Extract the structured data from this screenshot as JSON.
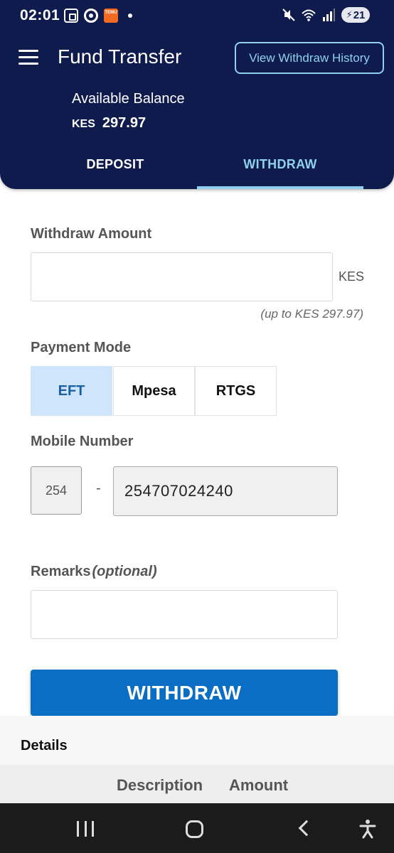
{
  "status_bar": {
    "time": "02:01",
    "temu_label": "TEMU",
    "battery_level": "21"
  },
  "header": {
    "title": "Fund Transfer",
    "history_button": "View Withdraw History",
    "balance_label": "Available Balance",
    "balance_currency": "KES",
    "balance_value": "297.97",
    "accent_color": "#8ed0ee",
    "background_color": "#0f1b4d"
  },
  "tabs": [
    {
      "label": "DEPOSIT",
      "active": false
    },
    {
      "label": "WITHDRAW",
      "active": true
    }
  ],
  "form": {
    "amount_label": "Withdraw Amount",
    "amount_value": "",
    "amount_currency": "KES",
    "amount_hint": "(up to KES 297.97)",
    "payment_mode_label": "Payment Mode",
    "payment_modes": [
      {
        "label": "EFT",
        "selected": true
      },
      {
        "label": "Mpesa",
        "selected": false
      },
      {
        "label": "RTGS",
        "selected": false
      }
    ],
    "mobile_label": "Mobile Number",
    "mobile_prefix": "254",
    "mobile_separator": "-",
    "mobile_value": "254707024240",
    "remarks_label": "Remarks",
    "remarks_optional": "(optional)",
    "remarks_value": "",
    "submit_label": "WITHDRAW",
    "submit_color": "#0a6ec4"
  },
  "details": {
    "title": "Details",
    "columns": [
      "Description",
      "Amount"
    ]
  }
}
